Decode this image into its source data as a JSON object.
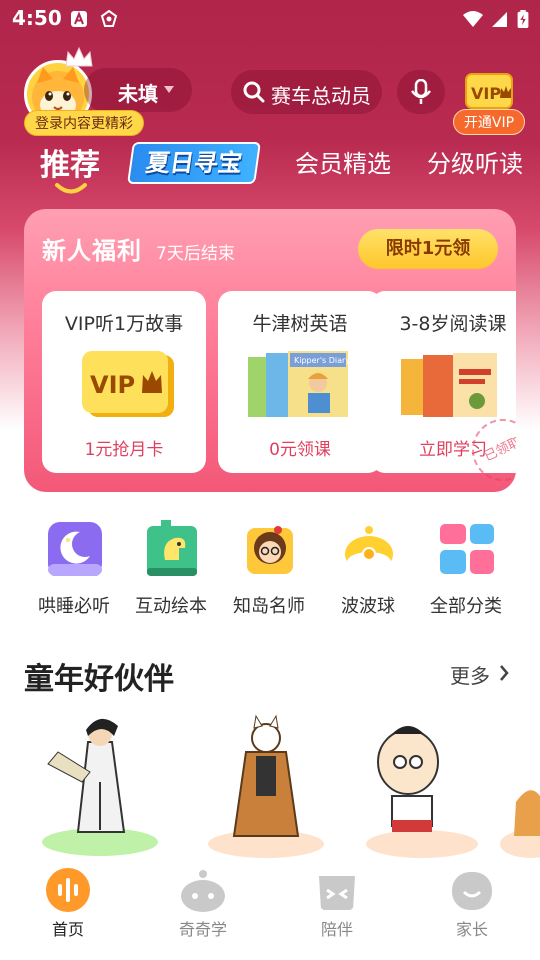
{
  "status_bar": {
    "time": "4:50"
  },
  "header": {
    "username": "未填",
    "login_badge": "登录内容更精彩",
    "search_text": "赛车总动员",
    "vip_badge": "VIP",
    "open_vip": "开通VIP"
  },
  "tabs": [
    {
      "label": "推荐",
      "active": true
    },
    {
      "label": "夏日寻宝"
    },
    {
      "label": "会员精选"
    },
    {
      "label": "分级听读"
    }
  ],
  "newbie": {
    "title": "新人福利",
    "subtitle": "7天后结束",
    "button": "限时1元领",
    "stamp": "已领取",
    "offers": [
      {
        "title": "VIP听1万故事",
        "cta": "1元抢月卡",
        "art_text": "VIP"
      },
      {
        "title": "牛津树英语",
        "cta": "0元领课",
        "art_text": "Kipper's Diary"
      },
      {
        "title": "3-8岁阅读课",
        "cta": "立即学习"
      }
    ]
  },
  "categories": [
    {
      "label": "哄睡必听",
      "icon": "moon-icon",
      "color": "#8b6cf0"
    },
    {
      "label": "互动绘本",
      "icon": "dino-book-icon",
      "color": "#3ec28a"
    },
    {
      "label": "知岛名师",
      "icon": "teacher-icon",
      "color": "#ffc83a"
    },
    {
      "label": "波波球",
      "icon": "ball-icon",
      "color": "#ffd030"
    },
    {
      "label": "全部分类",
      "icon": "grid-icon",
      "color": "#ff6f9a"
    }
  ],
  "section": {
    "title": "童年好伙伴",
    "more": "更多"
  },
  "bottom_nav": [
    {
      "label": "首页",
      "active": true
    },
    {
      "label": "奇奇学"
    },
    {
      "label": "陪伴"
    },
    {
      "label": "家长"
    }
  ],
  "colors": {
    "brand": "#b0254a",
    "accent": "#ff6f9a",
    "vip_gold": "#ffc62a"
  }
}
